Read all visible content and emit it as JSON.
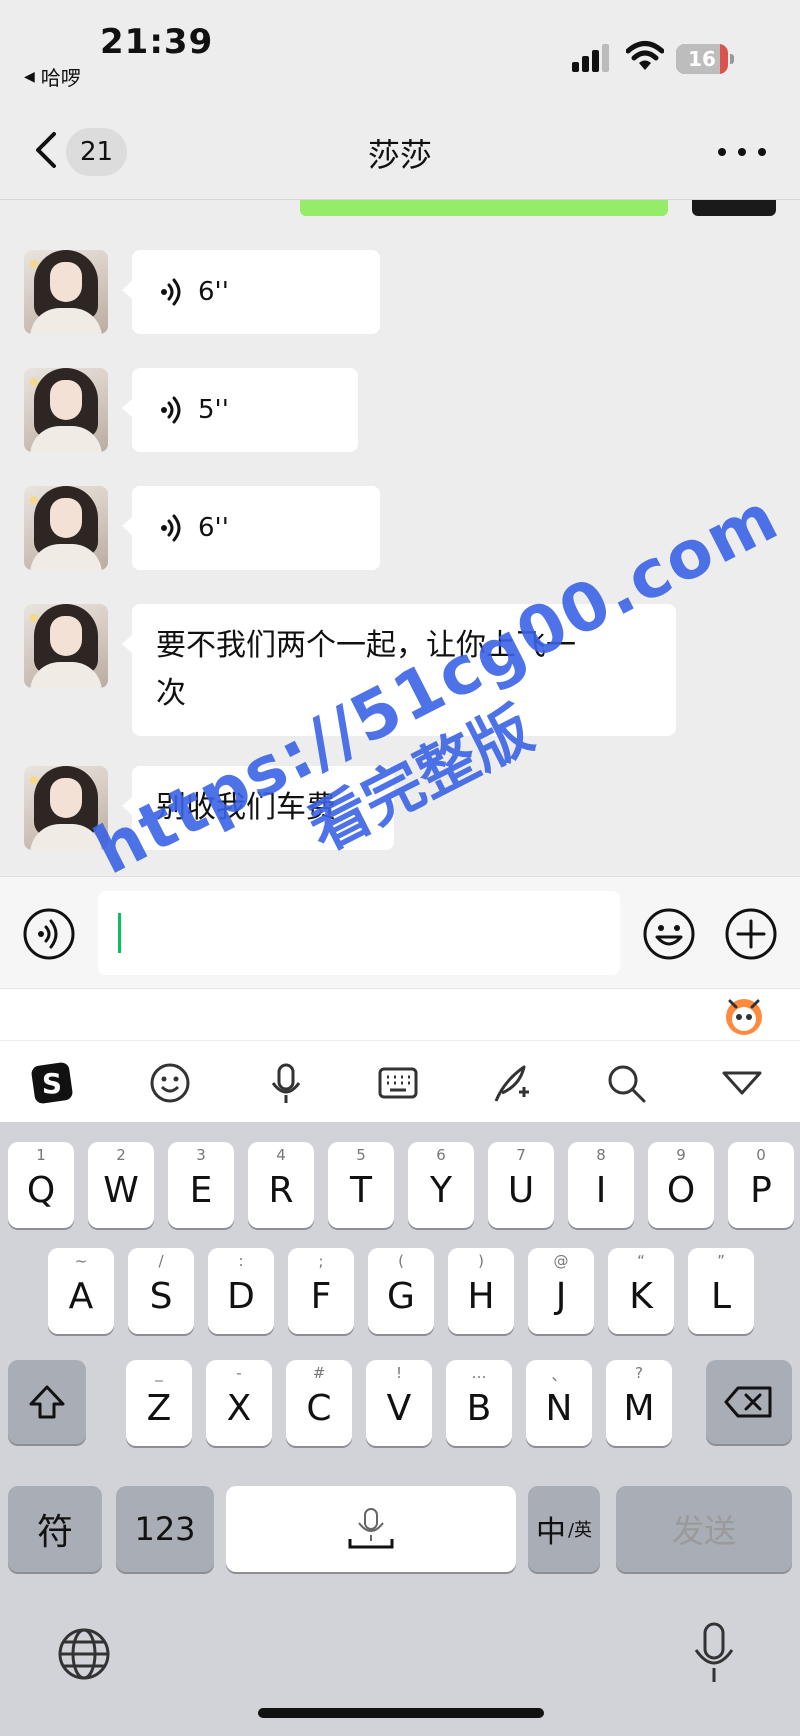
{
  "status_bar": {
    "time": "21:39",
    "back_app": "哈啰",
    "battery": "16",
    "battery_level": 0.16
  },
  "nav": {
    "unread_count": "21",
    "title": "莎莎"
  },
  "messages": [
    {
      "type": "voice",
      "duration": "6''"
    },
    {
      "type": "voice",
      "duration": "5''"
    },
    {
      "type": "voice",
      "duration": "6''"
    },
    {
      "type": "text",
      "lines": [
        "要不我们两个一起，让你上飞一",
        "次"
      ]
    },
    {
      "type": "text",
      "lines": [
        "别收我们车费"
      ]
    }
  ],
  "keyboard": {
    "row1": [
      {
        "hint": "1",
        "key": "Q"
      },
      {
        "hint": "2",
        "key": "W"
      },
      {
        "hint": "3",
        "key": "E"
      },
      {
        "hint": "4",
        "key": "R"
      },
      {
        "hint": "5",
        "key": "T"
      },
      {
        "hint": "6",
        "key": "Y"
      },
      {
        "hint": "7",
        "key": "U"
      },
      {
        "hint": "8",
        "key": "I"
      },
      {
        "hint": "9",
        "key": "O"
      },
      {
        "hint": "0",
        "key": "P"
      }
    ],
    "row2": [
      {
        "hint": "~",
        "key": "A"
      },
      {
        "hint": "/",
        "key": "S"
      },
      {
        "hint": ":",
        "key": "D"
      },
      {
        "hint": ";",
        "key": "F"
      },
      {
        "hint": "(",
        "key": "G"
      },
      {
        "hint": ")",
        "key": "H"
      },
      {
        "hint": "@",
        "key": "J"
      },
      {
        "hint": "“",
        "key": "K"
      },
      {
        "hint": "”",
        "key": "L"
      }
    ],
    "row3": [
      {
        "hint": "_",
        "key": "Z"
      },
      {
        "hint": "-",
        "key": "X"
      },
      {
        "hint": "#",
        "key": "C"
      },
      {
        "hint": "!",
        "key": "V"
      },
      {
        "hint": "…",
        "key": "B"
      },
      {
        "hint": "、",
        "key": "N"
      },
      {
        "hint": "?",
        "key": "M"
      }
    ],
    "symbols": "符",
    "numbers": "123",
    "lang_main": "中",
    "lang_sub": "/英",
    "send": "发送"
  },
  "watermark": {
    "line1": "https://51cg00.com",
    "line2": "看完整版"
  },
  "colors": {
    "background": "#ededed",
    "bubble": "#ffffff",
    "caret": "#07c160",
    "watermark": "#3b63e6",
    "battery": "#d9534f"
  },
  "icons": {
    "toolbar": [
      "sogou-logo-icon",
      "emoji-face-icon",
      "microphone-icon",
      "keyboard-icon",
      "quill-icon",
      "search-icon",
      "collapse-triangle-icon"
    ]
  }
}
